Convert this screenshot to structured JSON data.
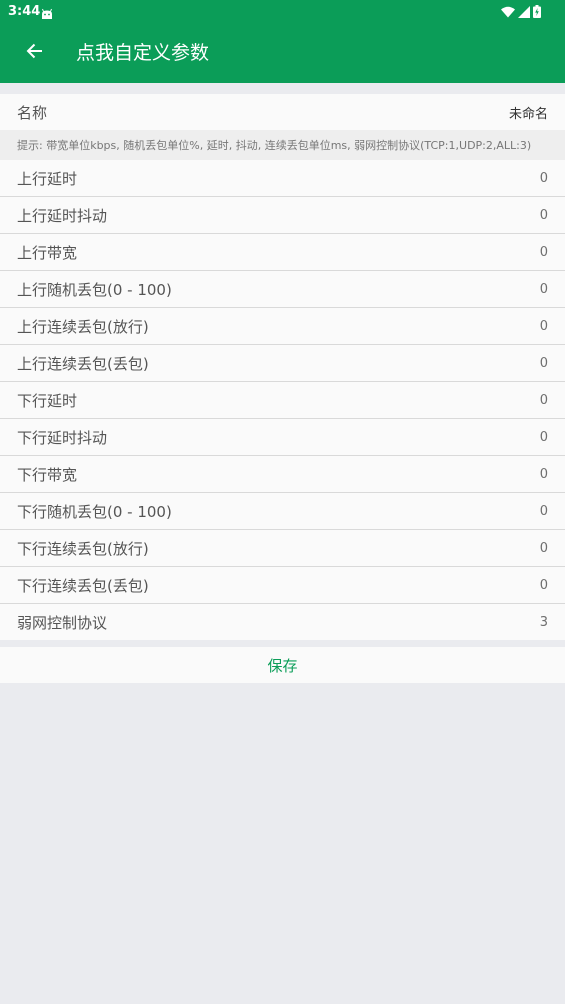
{
  "status_bar": {
    "time": "3:44",
    "notification_icon": "android-robot-icon",
    "wifi_icon": "wifi-icon",
    "signal_icon": "cellular-signal-icon",
    "battery_icon": "battery-charging-icon"
  },
  "app_bar": {
    "title": "点我自定义参数",
    "back_icon": "arrow-back-icon",
    "color": "#0b9d58"
  },
  "name_row": {
    "label": "名称",
    "value": "未命名"
  },
  "hint": "提示: 带宽单位kbps, 随机丢包单位%, 延时, 抖动, 连续丢包单位ms, 弱网控制协议(TCP:1,UDP:2,ALL:3)",
  "params": [
    {
      "label": "上行延时",
      "value": "0"
    },
    {
      "label": "上行延时抖动",
      "value": "0"
    },
    {
      "label": "上行带宽",
      "value": "0"
    },
    {
      "label": "上行随机丢包(0 - 100)",
      "value": "0"
    },
    {
      "label": "上行连续丢包(放行)",
      "value": "0"
    },
    {
      "label": "上行连续丢包(丢包)",
      "value": "0"
    },
    {
      "label": "下行延时",
      "value": "0"
    },
    {
      "label": "下行延时抖动",
      "value": "0"
    },
    {
      "label": "下行带宽",
      "value": "0"
    },
    {
      "label": "下行随机丢包(0 - 100)",
      "value": "0"
    },
    {
      "label": "下行连续丢包(放行)",
      "value": "0"
    },
    {
      "label": "下行连续丢包(丢包)",
      "value": "0"
    },
    {
      "label": "弱网控制协议",
      "value": "3"
    }
  ],
  "save_label": "保存"
}
